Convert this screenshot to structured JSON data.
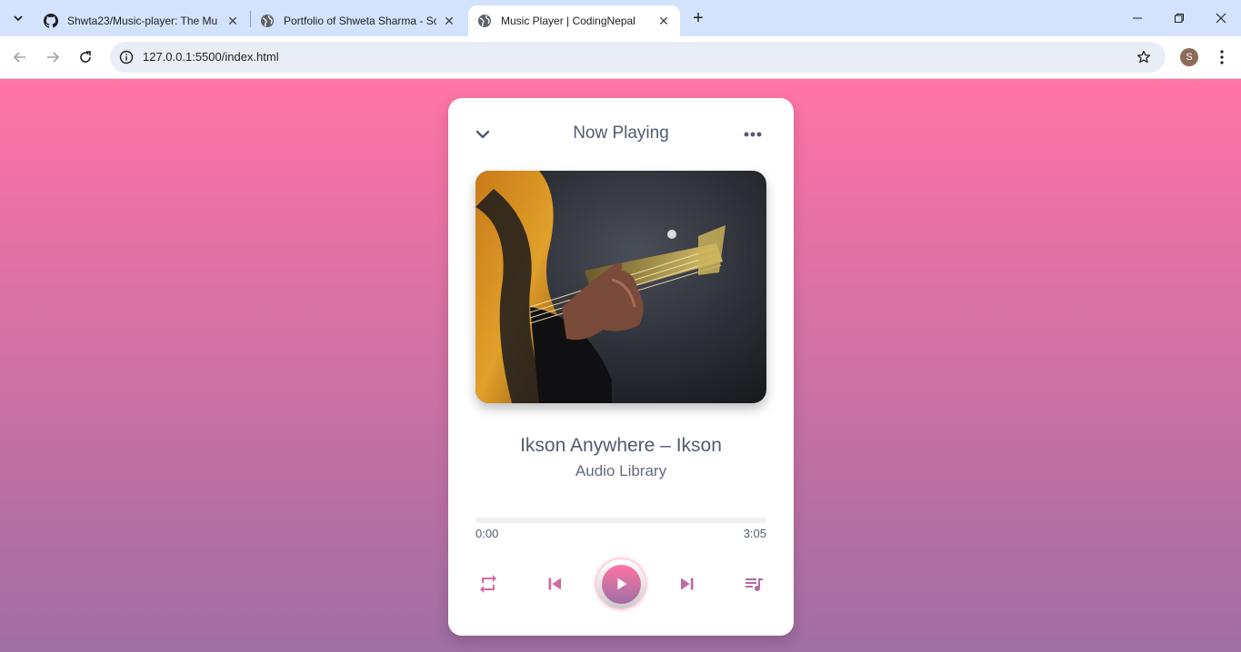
{
  "browser": {
    "tabs": [
      {
        "title": "Shwta23/Music-player: The Mu",
        "favicon": "github-icon",
        "active": false
      },
      {
        "title": "Portfolio of Shweta Sharma - Sc",
        "favicon": "globe-icon",
        "active": false
      },
      {
        "title": "Music Player | CodingNepal",
        "favicon": "globe-icon",
        "active": true
      }
    ],
    "url": "127.0.0.1:5500/index.html",
    "profile_initial": "S"
  },
  "player": {
    "heading": "Now Playing",
    "song_name": "Ikson Anywhere – Ikson",
    "artist": "Audio Library",
    "current_time": "0:00",
    "duration": "3:05",
    "progress": 0,
    "accent_start": "#ff74a4",
    "accent_end": "#9f6ea3",
    "text_color": "#515c6f",
    "icons": {
      "top_left": "chevron-down-icon",
      "top_right": "more-horizontal-icon",
      "repeat": "repeat-icon",
      "prev": "skip-previous-icon",
      "play": "play-icon",
      "next": "skip-next-icon",
      "playlist": "queue-music-icon"
    }
  }
}
